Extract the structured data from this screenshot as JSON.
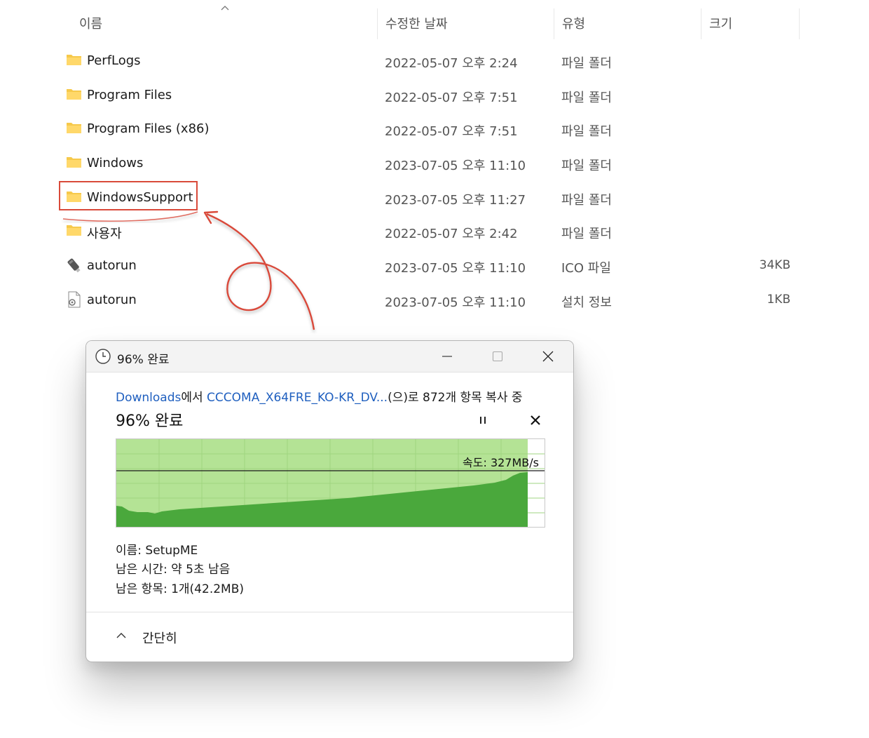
{
  "header": {
    "col_name": "이름",
    "col_date": "수정한 날짜",
    "col_type": "유형",
    "col_size": "크기",
    "sort_icon": "chevron-up-icon"
  },
  "files": [
    {
      "name": "PerfLogs",
      "date": "2022-05-07 오후 2:24",
      "type": "파일 폴더",
      "size": "",
      "icon": "folder-icon"
    },
    {
      "name": "Program Files",
      "date": "2022-05-07 오후 7:51",
      "type": "파일 폴더",
      "size": "",
      "icon": "folder-icon"
    },
    {
      "name": "Program Files (x86)",
      "date": "2022-05-07 오후 7:51",
      "type": "파일 폴더",
      "size": "",
      "icon": "folder-icon"
    },
    {
      "name": "Windows",
      "date": "2023-07-05 오후 11:10",
      "type": "파일 폴더",
      "size": "",
      "icon": "folder-icon"
    },
    {
      "name": "WindowsSupport",
      "date": "2023-07-05 오후 11:27",
      "type": "파일 폴더",
      "size": "",
      "icon": "folder-icon"
    },
    {
      "name": "사용자",
      "date": "2022-05-07 오후 2:42",
      "type": "파일 폴더",
      "size": "",
      "icon": "folder-icon"
    },
    {
      "name": "autorun",
      "date": "2023-07-05 오후 11:10",
      "type": "ICO 파일",
      "size": "34KB",
      "icon": "usb-drive-icon"
    },
    {
      "name": "autorun",
      "date": "2023-07-05 오후 11:10",
      "type": "설치 정보",
      "size": "1KB",
      "icon": "setup-info-icon"
    }
  ],
  "highlighted_item": "WindowsSupport",
  "colors": {
    "highlight": "#d94a3a",
    "folder": "#f6c94b",
    "graph_fill": "#4aa83c",
    "graph_bg": "#b4e395",
    "link": "#1f5fbf"
  },
  "dialog": {
    "title": "96% 완료",
    "title_icon": "clock-icon",
    "source_link": "Downloads",
    "text_from": "에서 ",
    "dest_link": "CCCOMA_X64FRE_KO-KR_DV...",
    "text_rest": "(으)로 872개 항목 복사 중",
    "percent_text": "96% 완료",
    "progress": 0.96,
    "speed_text": "속도: 327MB/s",
    "name_line": "이름: SetupME",
    "time_left_line": "남은 시간: 약 5초 남음",
    "items_left_line": "남은 항목: 1개(42.2MB)",
    "collapse_label": "간단히"
  }
}
